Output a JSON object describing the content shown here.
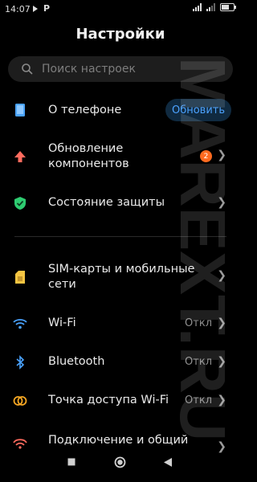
{
  "status_bar": {
    "time": "14:07",
    "battery": "57"
  },
  "header": {
    "title": "Настройки"
  },
  "search": {
    "placeholder": "Поиск настроек"
  },
  "items": [
    {
      "label": "О телефоне",
      "action_label": "Обновить",
      "icon": "phone-info-icon",
      "color": "#4aa3ff"
    },
    {
      "label": "Обновление\nкомпонентов",
      "badge": "2",
      "icon": "update-arrow-icon",
      "color": "#ff6b5e"
    },
    {
      "label": "Состояние защиты",
      "icon": "shield-check-icon",
      "color": "#2ecc71"
    },
    {
      "label": "SIM-карты и мобильные\nсети",
      "icon": "sim-card-icon",
      "color": "#f5c542"
    },
    {
      "label": "Wi-Fi",
      "value": "Откл",
      "icon": "wifi-icon",
      "color": "#4aa3ff"
    },
    {
      "label": "Bluetooth",
      "value": "Откл",
      "icon": "bluetooth-icon",
      "color": "#4aa3ff"
    },
    {
      "label": "Точка доступа Wi-Fi",
      "value": "Откл",
      "icon": "hotspot-icon",
      "color": "#f5a623"
    },
    {
      "label": "Подключение и общий",
      "icon": "connection-sharing-icon",
      "color": "#ff6b5e"
    }
  ],
  "watermark": "MAREXT.RU"
}
